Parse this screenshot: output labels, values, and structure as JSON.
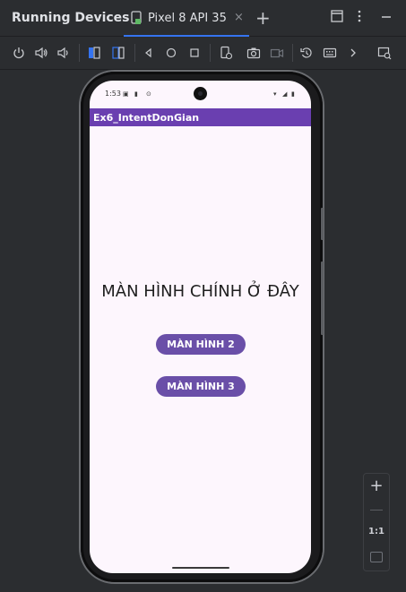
{
  "ide": {
    "panel_title": "Running Devices",
    "tab": {
      "label": "Pixel 8 API 35",
      "close": "×"
    },
    "add_tab": "+"
  },
  "toolbar_icons": [
    "power-icon",
    "volume-up-icon",
    "volume-down-icon",
    "rotate-left-icon",
    "rotate-right-icon",
    "back-icon",
    "home-icon",
    "overview-icon",
    "device-info-icon",
    "camera-icon",
    "screenrecord-icon",
    "reset-icon",
    "keyboard-icon",
    "more-icon",
    "window-icon"
  ],
  "device": {
    "status_time": "1:53",
    "app_title": "Ex6_IntentDonGian",
    "main_text": "MÀN HÌNH CHÍNH Ở ĐÂY",
    "buttons": [
      "MÀN HÌNH 2",
      "MÀN HÌNH 3"
    ]
  },
  "zoom": {
    "in": "+",
    "one_to_one": "1:1"
  },
  "colors": {
    "accent": "#3574f0",
    "app_bar": "#6a3fb0",
    "button": "#6a4fa8",
    "screen_bg": "#fdf6fd"
  }
}
